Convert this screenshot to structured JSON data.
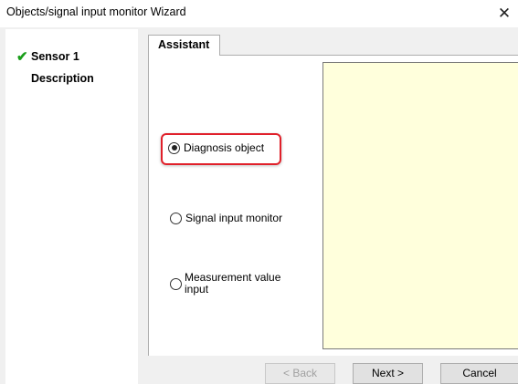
{
  "window": {
    "title": "Objects/signal input monitor Wizard",
    "close_glyph": "✕"
  },
  "sidebar": {
    "items": [
      {
        "label": "Sensor 1",
        "completed": true,
        "icon": "checkmark-icon"
      },
      {
        "label": "Description",
        "completed": false
      }
    ],
    "check_glyph": "✔",
    "check_color": "#1a9e1a"
  },
  "tabs": [
    {
      "label": "Assistant",
      "active": true
    }
  ],
  "options": [
    {
      "label": "Diagnosis object",
      "selected": true,
      "highlighted": true
    },
    {
      "label": "Signal input monitor",
      "selected": false
    },
    {
      "label": "Measurement value input",
      "line1": "Measurement value",
      "line2": "input",
      "selected": false
    }
  ],
  "preview": {
    "background": "#ffffdc"
  },
  "buttons": {
    "back": {
      "label": "< Back",
      "enabled": false
    },
    "next": {
      "label": "Next >",
      "enabled": true
    },
    "cancel": {
      "label": "Cancel",
      "enabled": true
    }
  },
  "colors": {
    "highlight": "#e0202a",
    "window_bg": "#f0f0f0"
  }
}
